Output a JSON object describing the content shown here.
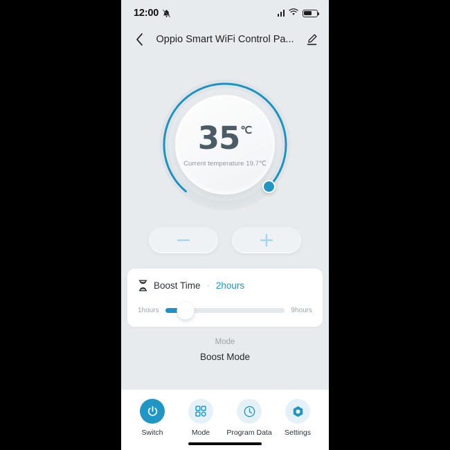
{
  "status_bar": {
    "time": "12:00",
    "mute_icon": "bell-muted-icon",
    "signal_icon": "cellular-signal-icon",
    "wifi_icon": "wifi-icon",
    "battery_icon": "battery-icon",
    "battery_level_pct": 60
  },
  "header": {
    "back_icon": "chevron-left-icon",
    "title": "Oppio Smart WiFi Control Pa...",
    "edit_icon": "pencil-edit-icon"
  },
  "dial": {
    "target_temperature": "35",
    "unit": "℃",
    "current_temperature_text": "Current temperature 19.7℃",
    "arc_color": "#1b92c0",
    "knob_color": "#2196c4",
    "arc_progress_pct": 76
  },
  "adjust": {
    "decrease_label": "−",
    "decrease_icon": "minus-icon",
    "increase_label": "+",
    "increase_icon": "plus-icon",
    "icon_color": "#a6d6e8"
  },
  "boost": {
    "icon": "hourglass-icon",
    "label": "Boost Time",
    "separator": "·",
    "value": "2hours",
    "value_color": "#2196c4",
    "slider": {
      "min_label": "1hours",
      "max_label": "9hours",
      "fill_color": "#1b95c2",
      "position_pct": 17
    }
  },
  "mode": {
    "label": "Mode",
    "value": "Boost Mode"
  },
  "nav": {
    "items": [
      {
        "label": "Switch",
        "icon": "power-icon",
        "active": true
      },
      {
        "label": "Mode",
        "icon": "grid-icon",
        "active": false
      },
      {
        "label": "Program Data",
        "icon": "clock-icon",
        "active": false
      },
      {
        "label": "Settings",
        "icon": "gear-hex-icon",
        "active": false
      }
    ],
    "active_color": "#2196c4",
    "inactive_bg": "#e4f2f7"
  }
}
